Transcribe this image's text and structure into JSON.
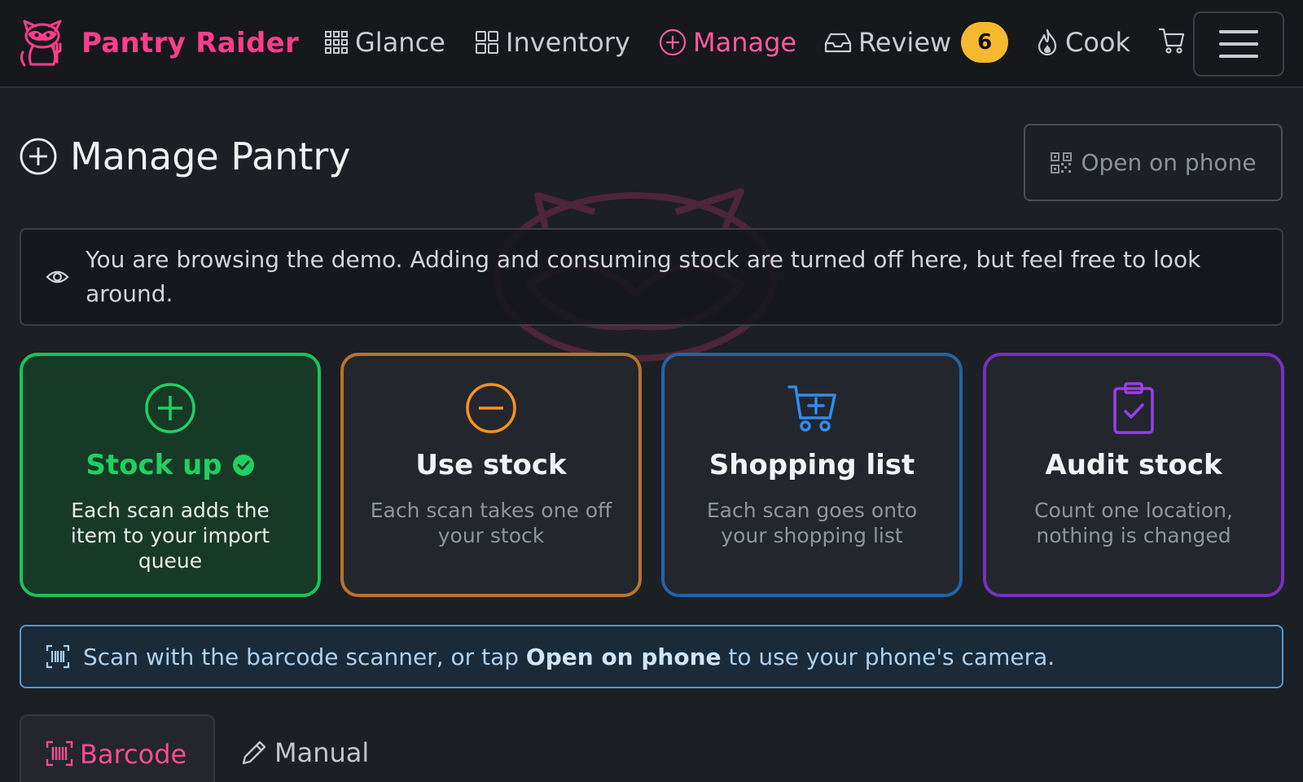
{
  "app": {
    "brand": "Pantry Raider",
    "brand_color": "#ff3d8b",
    "logo_icon": "raccoon-logo-icon"
  },
  "nav": {
    "items": [
      {
        "label": "Glance",
        "icon": "grid-icon"
      },
      {
        "label": "Inventory",
        "icon": "squares-icon"
      },
      {
        "label": "Manage",
        "icon": "plus-circle-icon",
        "active": true
      },
      {
        "label": "Review",
        "icon": "inbox-icon",
        "badge": "6"
      },
      {
        "label": "Cook",
        "icon": "fire-icon"
      }
    ],
    "cart_icon": "cart-icon",
    "menu_icon": "hamburger-icon"
  },
  "page": {
    "title": "Manage Pantry",
    "title_icon": "plus-circle-icon",
    "open_phone_label": "Open on phone",
    "open_phone_icon": "qr-code-icon"
  },
  "demo_alert": {
    "icon": "eye-icon",
    "text": "You are browsing the demo. Adding and consuming stock are turned off here, but feel free to look around."
  },
  "modes": [
    {
      "title": "Stock up",
      "desc": "Each scan adds the item to your import queue",
      "color": "#19c45a",
      "icon": "plus-circle-icon",
      "selected": true
    },
    {
      "title": "Use stock",
      "desc": "Each scan takes one off your stock",
      "color": "#f7931e",
      "icon": "minus-circle-icon"
    },
    {
      "title": "Shopping list",
      "desc": "Each scan goes onto your shopping list",
      "color": "#2f8cf0",
      "icon": "cart-plus-icon"
    },
    {
      "title": "Audit stock",
      "desc": "Count one location, nothing is changed",
      "color": "#9b3df0",
      "icon": "clipboard-check-icon"
    }
  ],
  "scan_info": {
    "icon": "barcode-scan-icon",
    "prefix": "Scan with the barcode scanner, or tap ",
    "strong": "Open on phone",
    "suffix": " to use your phone's camera."
  },
  "tabs": [
    {
      "label": "Barcode",
      "icon": "barcode-icon",
      "active": true
    },
    {
      "label": "Manual",
      "icon": "pencil-icon"
    }
  ]
}
